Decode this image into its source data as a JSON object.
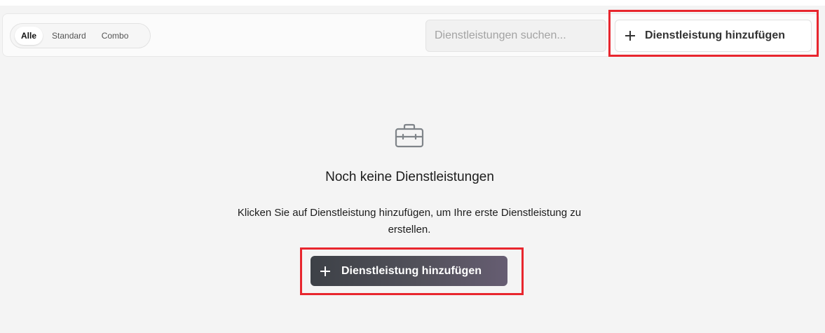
{
  "filters": {
    "tabs": [
      {
        "label": "Alle",
        "active": true
      },
      {
        "label": "Standard",
        "active": false
      },
      {
        "label": "Combo",
        "active": false
      }
    ]
  },
  "search": {
    "placeholder": "Dienstleistungen suchen...",
    "value": ""
  },
  "toolbar": {
    "add_label": "Dienstleistung hinzufügen",
    "add_icon": "plus-icon"
  },
  "empty_state": {
    "icon": "toolbox-icon",
    "title": "Noch keine Dienstleistungen",
    "description": "Klicken Sie auf Dienstleistung hinzufügen, um Ihre erste Dienstleistung zu erstellen.",
    "button_label": "Dienstleistung hinzufügen"
  },
  "colors": {
    "highlight": "#e8262e",
    "primary_button_start": "#3d4147",
    "primary_button_end": "#665d72",
    "background": "#f4f4f4"
  }
}
